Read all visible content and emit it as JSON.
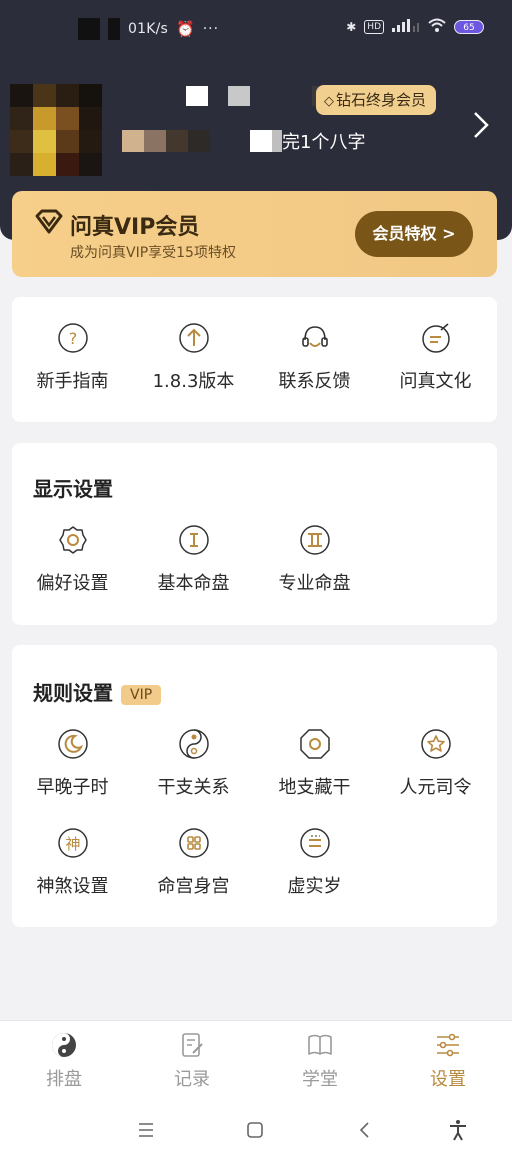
{
  "status_bar": {
    "speed": "01K/s",
    "alarm_icon": "alarm-icon",
    "dots": "···",
    "bt_icon": "bluetooth-icon",
    "hd": "HD",
    "net": "5G",
    "battery": "65"
  },
  "profile": {
    "badge": "钻石终身会员",
    "subtitle": "完1个八字"
  },
  "vip_banner": {
    "title": "问真VIP会员",
    "subtitle": "成为问真VIP享受15项特权",
    "button": "会员特权 >"
  },
  "quick_links": [
    {
      "label": "新手指南",
      "icon": "question-icon"
    },
    {
      "label": "1.8.3版本",
      "icon": "upload-icon"
    },
    {
      "label": "联系反馈",
      "icon": "headset-icon"
    },
    {
      "label": "问真文化",
      "icon": "notes-icon"
    }
  ],
  "display_settings": {
    "title": "显示设置",
    "items": [
      {
        "label": "偏好设置",
        "icon": "gear-icon"
      },
      {
        "label": "基本命盘",
        "icon": "roman-one-icon"
      },
      {
        "label": "专业命盘",
        "icon": "roman-two-icon"
      }
    ]
  },
  "rule_settings": {
    "title": "规则设置",
    "tag": "VIP",
    "items": [
      {
        "label": "早晚子时",
        "icon": "moon-icon"
      },
      {
        "label": "干支关系",
        "icon": "yin-yang-icon"
      },
      {
        "label": "地支藏干",
        "icon": "octagon-icon"
      },
      {
        "label": "人元司令",
        "icon": "star-icon"
      },
      {
        "label": "神煞设置",
        "icon": "shen-icon",
        "glyph": "神"
      },
      {
        "label": "命宫身宫",
        "icon": "grid-icon"
      },
      {
        "label": "虚实岁",
        "icon": "equal-icon"
      }
    ]
  },
  "bottom_nav": [
    {
      "label": "排盘",
      "icon": "yin-yang-icon"
    },
    {
      "label": "记录",
      "icon": "edit-doc-icon"
    },
    {
      "label": "学堂",
      "icon": "book-icon"
    },
    {
      "label": "设置",
      "icon": "sliders-icon",
      "active": true
    }
  ],
  "colors": {
    "header": "#2c2d3a",
    "gold": "#b98a3f",
    "vip_banner": "#f6cf8a",
    "vip_button": "#7a5518"
  }
}
